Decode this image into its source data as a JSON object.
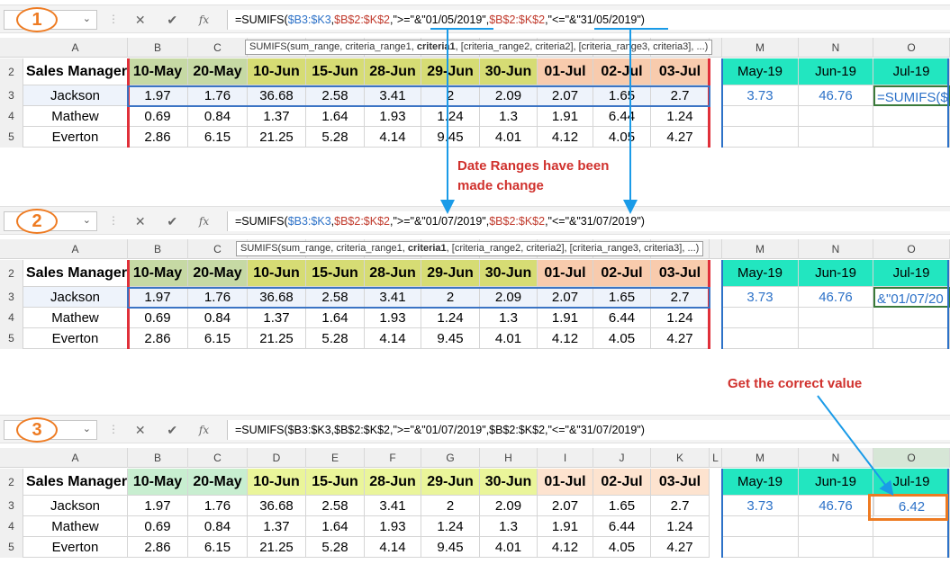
{
  "panels": [
    {
      "badge": "1",
      "formula_parts": [
        "=SUMIFS(",
        "$B3:$K3",
        ",",
        "$B$2:$K$2",
        ",\">=\"&\"01/05/2019\",",
        "$B$2:$K$2",
        ",\"<=\"&\"31/05/2019\")"
      ],
      "tooltip": [
        "SUMIFS(sum_range, criteria_range1, ",
        "criteria1",
        ", [criteria_range2, criteria2], [criteria_range3, criteria3], ...)"
      ],
      "o3": "=SUMIFS($",
      "show_col_letters": false
    },
    {
      "badge": "2",
      "formula_parts": [
        "=SUMIFS(",
        "$B3:$K3",
        ",",
        "$B$2:$K$2",
        ",\">=\"&\"01/07/2019\",",
        "$B$2:$K$2",
        ",\"<=\"&\"31/07/2019\")"
      ],
      "tooltip": [
        "SUMIFS(sum_range, criteria_range1, ",
        "criteria1",
        ", [criteria_range2, criteria2], [criteria_range3, criteria3], ...)"
      ],
      "o3": "&\"01/07/20",
      "show_col_letters": false
    },
    {
      "badge": "3",
      "formula_parts": [
        "=SUMIFS($B3:$K3,$B$2:$K$2,\">=\"&\"01/07/2019\",$B$2:$K$2,\"<=\"&\"31/07/2019\")"
      ],
      "tooltip": null,
      "o3": "6.42",
      "show_col_letters": true
    }
  ],
  "columns": {
    "letters_short": [
      "A",
      "B",
      "C",
      "",
      "",
      "",
      "",
      "",
      "",
      "",
      "",
      "",
      "M",
      "N",
      "O"
    ],
    "letters_full": [
      "A",
      "B",
      "C",
      "D",
      "E",
      "F",
      "G",
      "H",
      "I",
      "J",
      "K",
      "L",
      "M",
      "N",
      "O"
    ]
  },
  "rows": [
    "2",
    "3",
    "4",
    "5"
  ],
  "header_row": [
    "Sales Manager",
    "10-May",
    "20-May",
    "10-Jun",
    "15-Jun",
    "28-Jun",
    "29-Jun",
    "30-Jun",
    "01-Jul",
    "02-Jul",
    "03-Jul"
  ],
  "data_rows": [
    [
      "Jackson",
      "1.97",
      "1.76",
      "36.68",
      "2.58",
      "3.41",
      "2",
      "2.09",
      "2.07",
      "1.65",
      "2.7"
    ],
    [
      "Mathew",
      "0.69",
      "0.84",
      "1.37",
      "1.64",
      "1.93",
      "1.24",
      "1.3",
      "1.91",
      "6.44",
      "1.24"
    ],
    [
      "Everton",
      "2.86",
      "6.15",
      "21.25",
      "5.28",
      "4.14",
      "9.45",
      "4.01",
      "4.12",
      "4.05",
      "4.27"
    ]
  ],
  "summary": {
    "headers": [
      "May-19",
      "Jun-19",
      "Jul-19"
    ],
    "m3": "3.73",
    "n3": "46.76"
  },
  "annotations": {
    "date_ranges": "Date Ranges have been made change",
    "correct_value": "Get the correct value"
  },
  "colors": {
    "may_header": "#c6d9a4",
    "jun_header": "#d6dc74",
    "jul_header": "#f8cbad",
    "summary_header": "#22e6c0",
    "accent_orange": "#ee7b22",
    "arrow_blue": "#1a9be8"
  }
}
